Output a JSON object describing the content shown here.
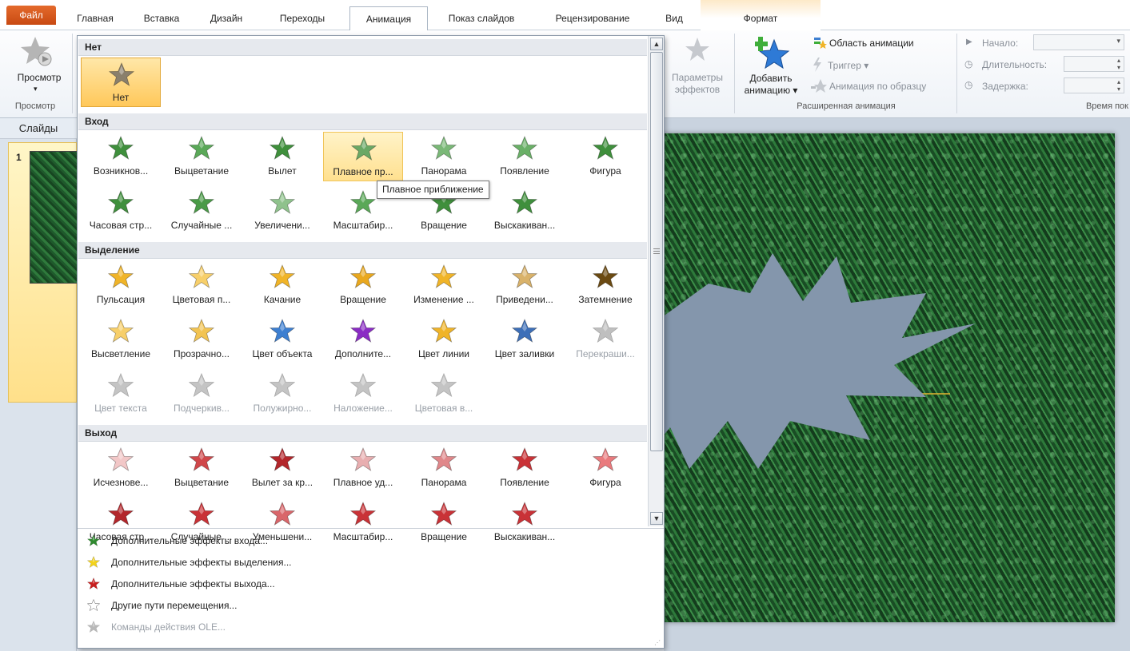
{
  "tabs": [
    {
      "label": "Файл",
      "state": "file"
    },
    {
      "label": "Главная",
      "state": "normal"
    },
    {
      "label": "Вставка",
      "state": "normal"
    },
    {
      "label": "Дизайн",
      "state": "normal"
    },
    {
      "label": "Переходы",
      "state": "normal"
    },
    {
      "label": "Анимация",
      "state": "active"
    },
    {
      "label": "Показ слайдов",
      "state": "normal"
    },
    {
      "label": "Рецензирование",
      "state": "normal"
    },
    {
      "label": "Вид",
      "state": "normal"
    },
    {
      "label": "Формат",
      "state": "contextual"
    }
  ],
  "ribbon": {
    "preview_button": "Просмотр",
    "preview_group": "Просмотр",
    "effect_params": "Параметры эффектов",
    "effect_params_l1": "Параметры",
    "effect_params_l2": "эффектов",
    "add_animation_l1": "Добавить",
    "add_animation_l2": "анимацию",
    "animation_pane": "Область анимации",
    "trigger": "Триггер",
    "animation_painter": "Анимация по образцу",
    "advanced_group": "Расширенная анимация",
    "start_label": "Начало:",
    "duration_label": "Длительность:",
    "delay_label": "Задержка:",
    "timing_group": "Время пок"
  },
  "slides_pane": {
    "title": "Слайды",
    "slide_number": "1"
  },
  "gallery": {
    "sections": [
      {
        "title": "Нет",
        "items": [
          {
            "label": "Нет",
            "color": "#8a7f6c",
            "state": "selected"
          }
        ]
      },
      {
        "title": "Вход",
        "items": [
          {
            "label": "Возникнов...",
            "color": "#3f8f3c"
          },
          {
            "label": "Выцветание",
            "color": "#5aa858"
          },
          {
            "label": "Вылет",
            "color": "#3f8f3c"
          },
          {
            "label": "Плавное пр...",
            "color": "#6aa865",
            "state": "hover"
          },
          {
            "label": "Панорама",
            "color": "#7ab877"
          },
          {
            "label": "Появление",
            "color": "#6ab067"
          },
          {
            "label": "Фигура",
            "color": "#3f8f3c"
          },
          {
            "label": "Часовая стр...",
            "color": "#3f8f3c"
          },
          {
            "label": "Случайные ...",
            "color": "#4a9a47"
          },
          {
            "label": "Увеличени...",
            "color": "#8fc28c"
          },
          {
            "label": "Масштабир...",
            "color": "#5aa858"
          },
          {
            "label": "Вращение",
            "color": "#3f8f3c"
          },
          {
            "label": "Выскакиван...",
            "color": "#3f8f3c"
          }
        ]
      },
      {
        "title": "Выделение",
        "items": [
          {
            "label": "Пульсация",
            "color": "#f0b428"
          },
          {
            "label": "Цветовая п...",
            "color": "#f7cf6a"
          },
          {
            "label": "Качание",
            "color": "#f0b428"
          },
          {
            "label": "Вращение",
            "color": "#e9a81f"
          },
          {
            "label": "Изменение ...",
            "color": "#f0b428"
          },
          {
            "label": "Приведени...",
            "color": "#d9b26a"
          },
          {
            "label": "Затемнение",
            "color": "#6b4a12"
          },
          {
            "label": "Высветление",
            "color": "#f7cf6a"
          },
          {
            "label": "Прозрачно...",
            "color": "#f2c453"
          },
          {
            "label": "Цвет объекта",
            "color": "#3d7fd1"
          },
          {
            "label": "Дополните...",
            "color": "#8a2cc4"
          },
          {
            "label": "Цвет линии",
            "color": "#f0b428"
          },
          {
            "label": "Цвет заливки",
            "color": "#3d6fb8"
          },
          {
            "label": "Перекраши...",
            "color": "#bfbfbf",
            "state": "disabled"
          },
          {
            "label": "Цвет текста",
            "color": "#c4c4c4",
            "state": "disabled"
          },
          {
            "label": "Подчеркив...",
            "color": "#c4c4c4",
            "state": "disabled"
          },
          {
            "label": "Полужирно...",
            "color": "#c4c4c4",
            "state": "disabled"
          },
          {
            "label": "Наложение...",
            "color": "#c4c4c4",
            "state": "disabled"
          },
          {
            "label": "Цветовая в...",
            "color": "#c4c4c4",
            "state": "disabled"
          }
        ]
      },
      {
        "title": "Выход",
        "items": [
          {
            "label": "Исчезнове...",
            "color": "#f2c7c7"
          },
          {
            "label": "Выцветание",
            "color": "#d0474a"
          },
          {
            "label": "Вылет за кр...",
            "color": "#b3262b"
          },
          {
            "label": "Плавное уд...",
            "color": "#e8aeb0"
          },
          {
            "label": "Панорама",
            "color": "#e0878a"
          },
          {
            "label": "Появление",
            "color": "#c93237"
          },
          {
            "label": "Фигура",
            "color": "#e97a7d"
          },
          {
            "label": "Часовая стр...",
            "color": "#b3262b"
          },
          {
            "label": "Случайные ...",
            "color": "#c93237"
          },
          {
            "label": "Уменьшени...",
            "color": "#d9666a"
          },
          {
            "label": "Масштабир...",
            "color": "#c93237"
          },
          {
            "label": "Вращение",
            "color": "#c93237"
          },
          {
            "label": "Выскакиван...",
            "color": "#c93237"
          }
        ]
      }
    ],
    "more_effects": [
      {
        "label": "Дополнительные эффекты входа...",
        "color": "#2f8a2f",
        "state": "normal"
      },
      {
        "label": "Дополнительные эффекты выделения...",
        "color": "#f2d21a",
        "state": "normal"
      },
      {
        "label": "Дополнительные эффекты выхода...",
        "color": "#c81e1e",
        "state": "normal"
      },
      {
        "label": "Другие пути перемещения...",
        "color": "#ffffff",
        "state": "normal"
      },
      {
        "label": "Команды действия OLE...",
        "color": "#b8b8b8",
        "state": "disabled"
      }
    ]
  },
  "tooltip": "Плавное приближение",
  "colors": {
    "shape_fill": "#8496ac",
    "accent_orange": "#e46a2c"
  }
}
